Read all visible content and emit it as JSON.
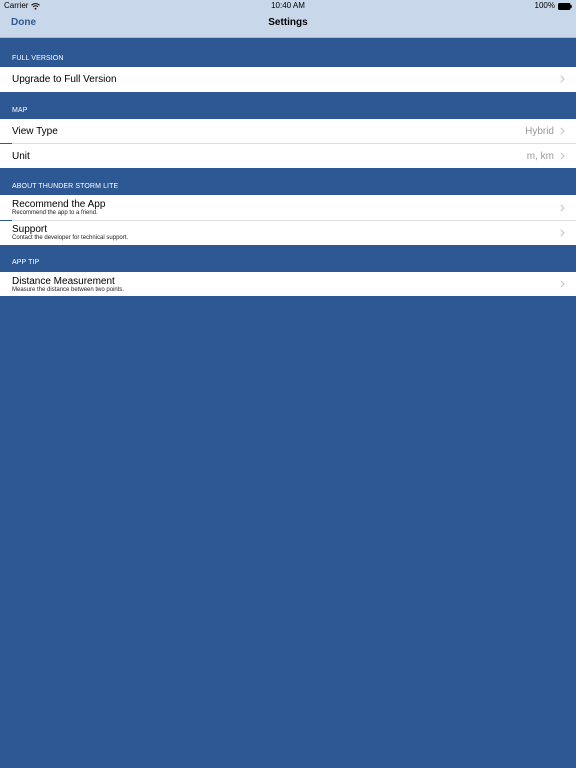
{
  "status_bar": {
    "carrier": "Carrier",
    "time": "10:40 AM",
    "battery": "100%"
  },
  "nav": {
    "done_label": "Done",
    "title": "Settings"
  },
  "sections": {
    "full_version": {
      "header": "FULL VERSION",
      "upgrade": {
        "title": "Upgrade to Full Version"
      }
    },
    "map": {
      "header": "MAP",
      "view_type": {
        "title": "View Type",
        "value": "Hybrid"
      },
      "unit": {
        "title": "Unit",
        "value": "m, km"
      }
    },
    "about": {
      "header": "ABOUT THUNDER STORM LITE",
      "recommend": {
        "title": "Recommend the App",
        "subtitle": "Recommend the app to a friend."
      },
      "support": {
        "title": "Support",
        "subtitle": "Contact the developer for technical support."
      }
    },
    "app_tip": {
      "header": "APP TIP",
      "distance": {
        "title": "Distance Measurement",
        "subtitle": "Measure the distance between two points."
      }
    }
  },
  "icons": {
    "wifi": "wifi-icon",
    "battery": "battery-icon",
    "chevron": "chevron-right-icon"
  },
  "colors": {
    "background": "#2e5893",
    "bar": "#c9d7ea",
    "accent": "#2e5893",
    "cell": "#ffffff",
    "secondary_text": "#9a9a9f"
  }
}
